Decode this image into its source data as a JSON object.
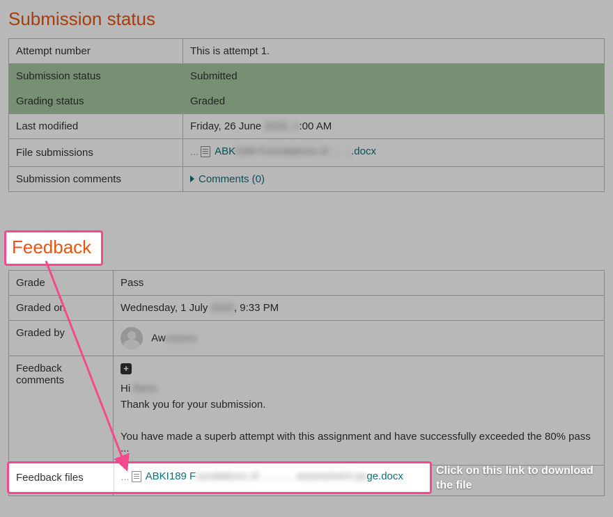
{
  "submission": {
    "heading": "Submission status",
    "rows": {
      "attempt_label": "Attempt number",
      "attempt_value": "This is attempt 1.",
      "status_label": "Submission status",
      "status_value": "Submitted",
      "grading_label": "Grading status",
      "grading_value": "Graded",
      "modified_label": "Last modified",
      "modified_prefix": "Friday, 26 June",
      "modified_blur": "2020, 1",
      "modified_suffix": ":00 AM",
      "files_label": "File submissions",
      "file_name_prefix": "ABK",
      "file_name_blur": "I189 Foundations of ... ...",
      "file_name_suffix": ".docx",
      "comments_label": "Submission comments",
      "comments_link": "Comments (0)"
    }
  },
  "feedback": {
    "heading": "Feedback",
    "grade_label": "Grade",
    "grade_value": "Pass",
    "graded_on_label": "Graded on",
    "graded_on_prefix": "Wednesday, 1 July",
    "graded_on_blur": "2020",
    "graded_on_suffix": ", 9:33 PM",
    "graded_by_label": "Graded by",
    "grader_prefix": "Aw",
    "grader_blur": "esome",
    "comments_label": "Feedback comments",
    "greeting_prefix": "Hi",
    "greeting_blur": "there",
    "line1": "Thank you for your submission.",
    "line2": "You have made a superb attempt with this assignment and have successfully exceeded the 80% pass ...",
    "files_label": "Feedback files",
    "file_name_prefix": "ABKI189 F",
    "file_name_blur": "oundations of ... ... ... assessment pa",
    "file_name_suffix": "ge.docx"
  },
  "annotation": {
    "callout": "Click on this link to download the file"
  }
}
